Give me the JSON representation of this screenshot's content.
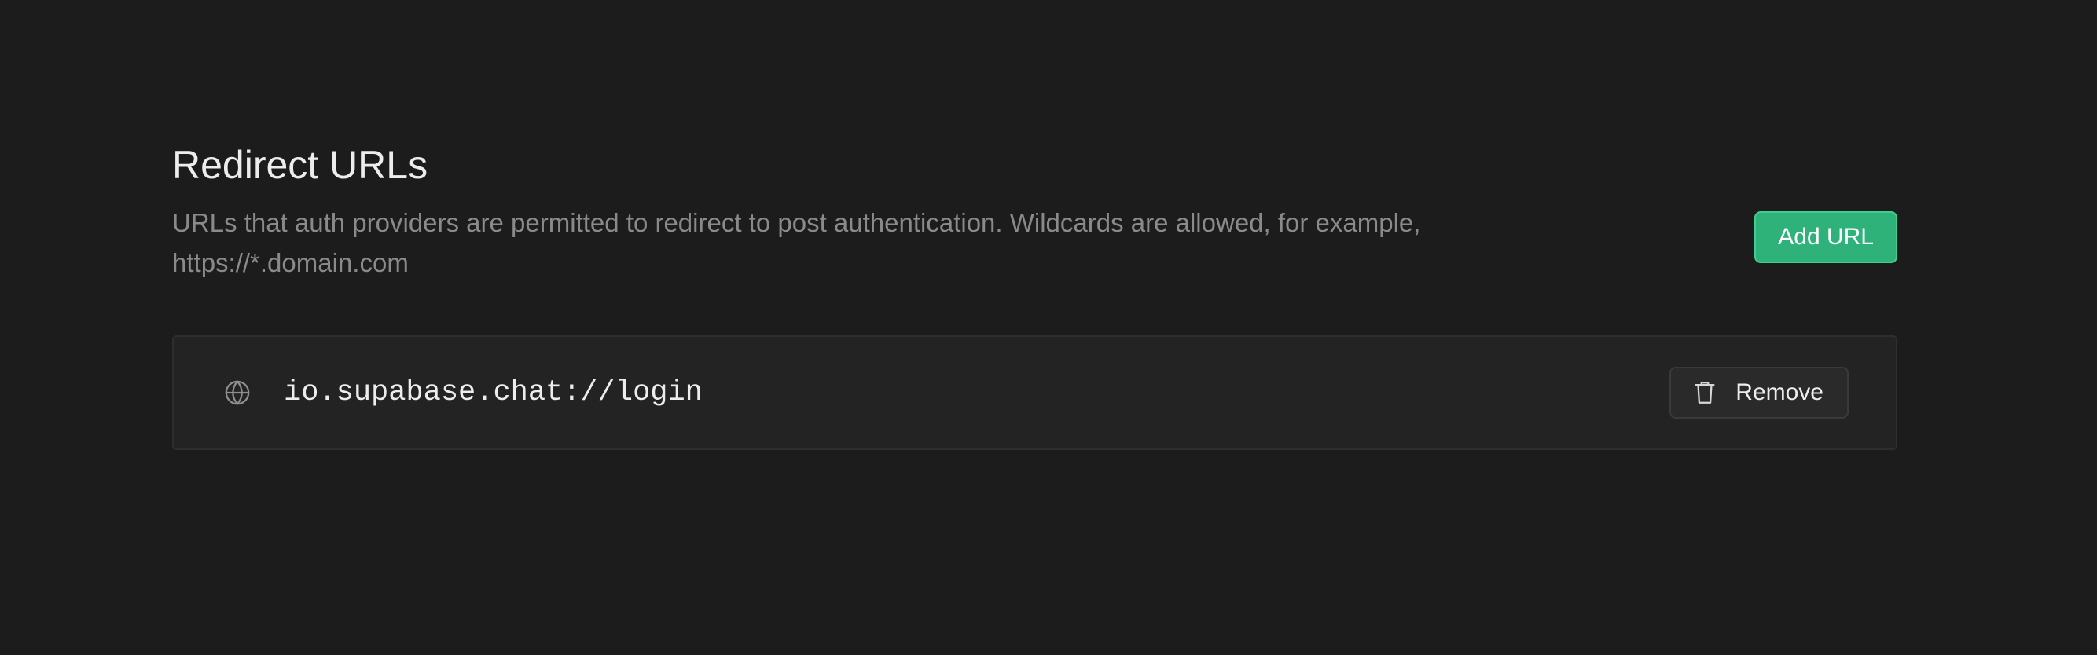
{
  "section": {
    "title": "Redirect URLs",
    "description": "URLs that auth providers are permitted to redirect to post authentication. Wildcards are allowed, for example, https://*.domain.com",
    "add_button_label": "Add URL"
  },
  "urls": [
    {
      "value": "io.supabase.chat://login",
      "icon": "globe-icon",
      "remove_label": "Remove",
      "remove_icon": "trash-icon"
    }
  ],
  "colors": {
    "background": "#1c1c1c",
    "accent": "#3ecf8e",
    "card": "#232323"
  }
}
